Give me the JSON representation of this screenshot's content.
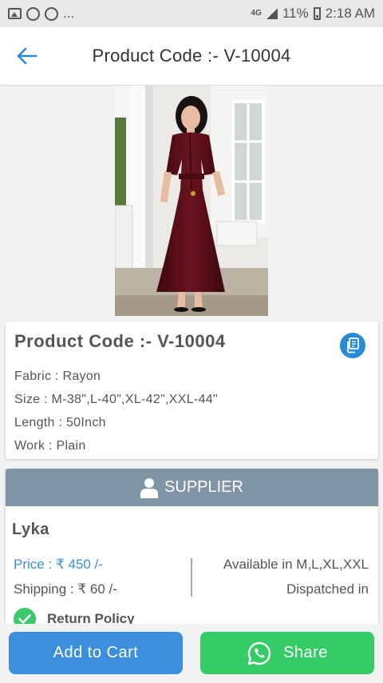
{
  "status_bar": {
    "ellipsis": "...",
    "network": "4G",
    "battery": "11%",
    "time": "2:18 AM"
  },
  "header": {
    "title": "Product Code :- V-10004"
  },
  "product": {
    "title": "Product Code :- V-10004",
    "attributes": [
      "Fabric : Rayon",
      "Size : M-38\",L-40\",XL-42\",XXL-44\"",
      "Length : 50Inch",
      "Work : Plain"
    ]
  },
  "supplier": {
    "header": "SUPPLIER",
    "name": "Lyka",
    "price_label": "Price : ",
    "price_value": "₹ 450 /-",
    "shipping": "Shipping : ₹ 60 /-",
    "available": "Available in M,L,XL,XXL",
    "dispatched": "Dispatched in",
    "return_policy": "Return Policy"
  },
  "actions": {
    "add_to_cart": "Add to Cart",
    "share": "Share"
  },
  "colors": {
    "accent": "#3b8fdd",
    "whatsapp": "#33cc66",
    "supplier_header": "#7f95a6",
    "dress": "#5a0f17"
  }
}
